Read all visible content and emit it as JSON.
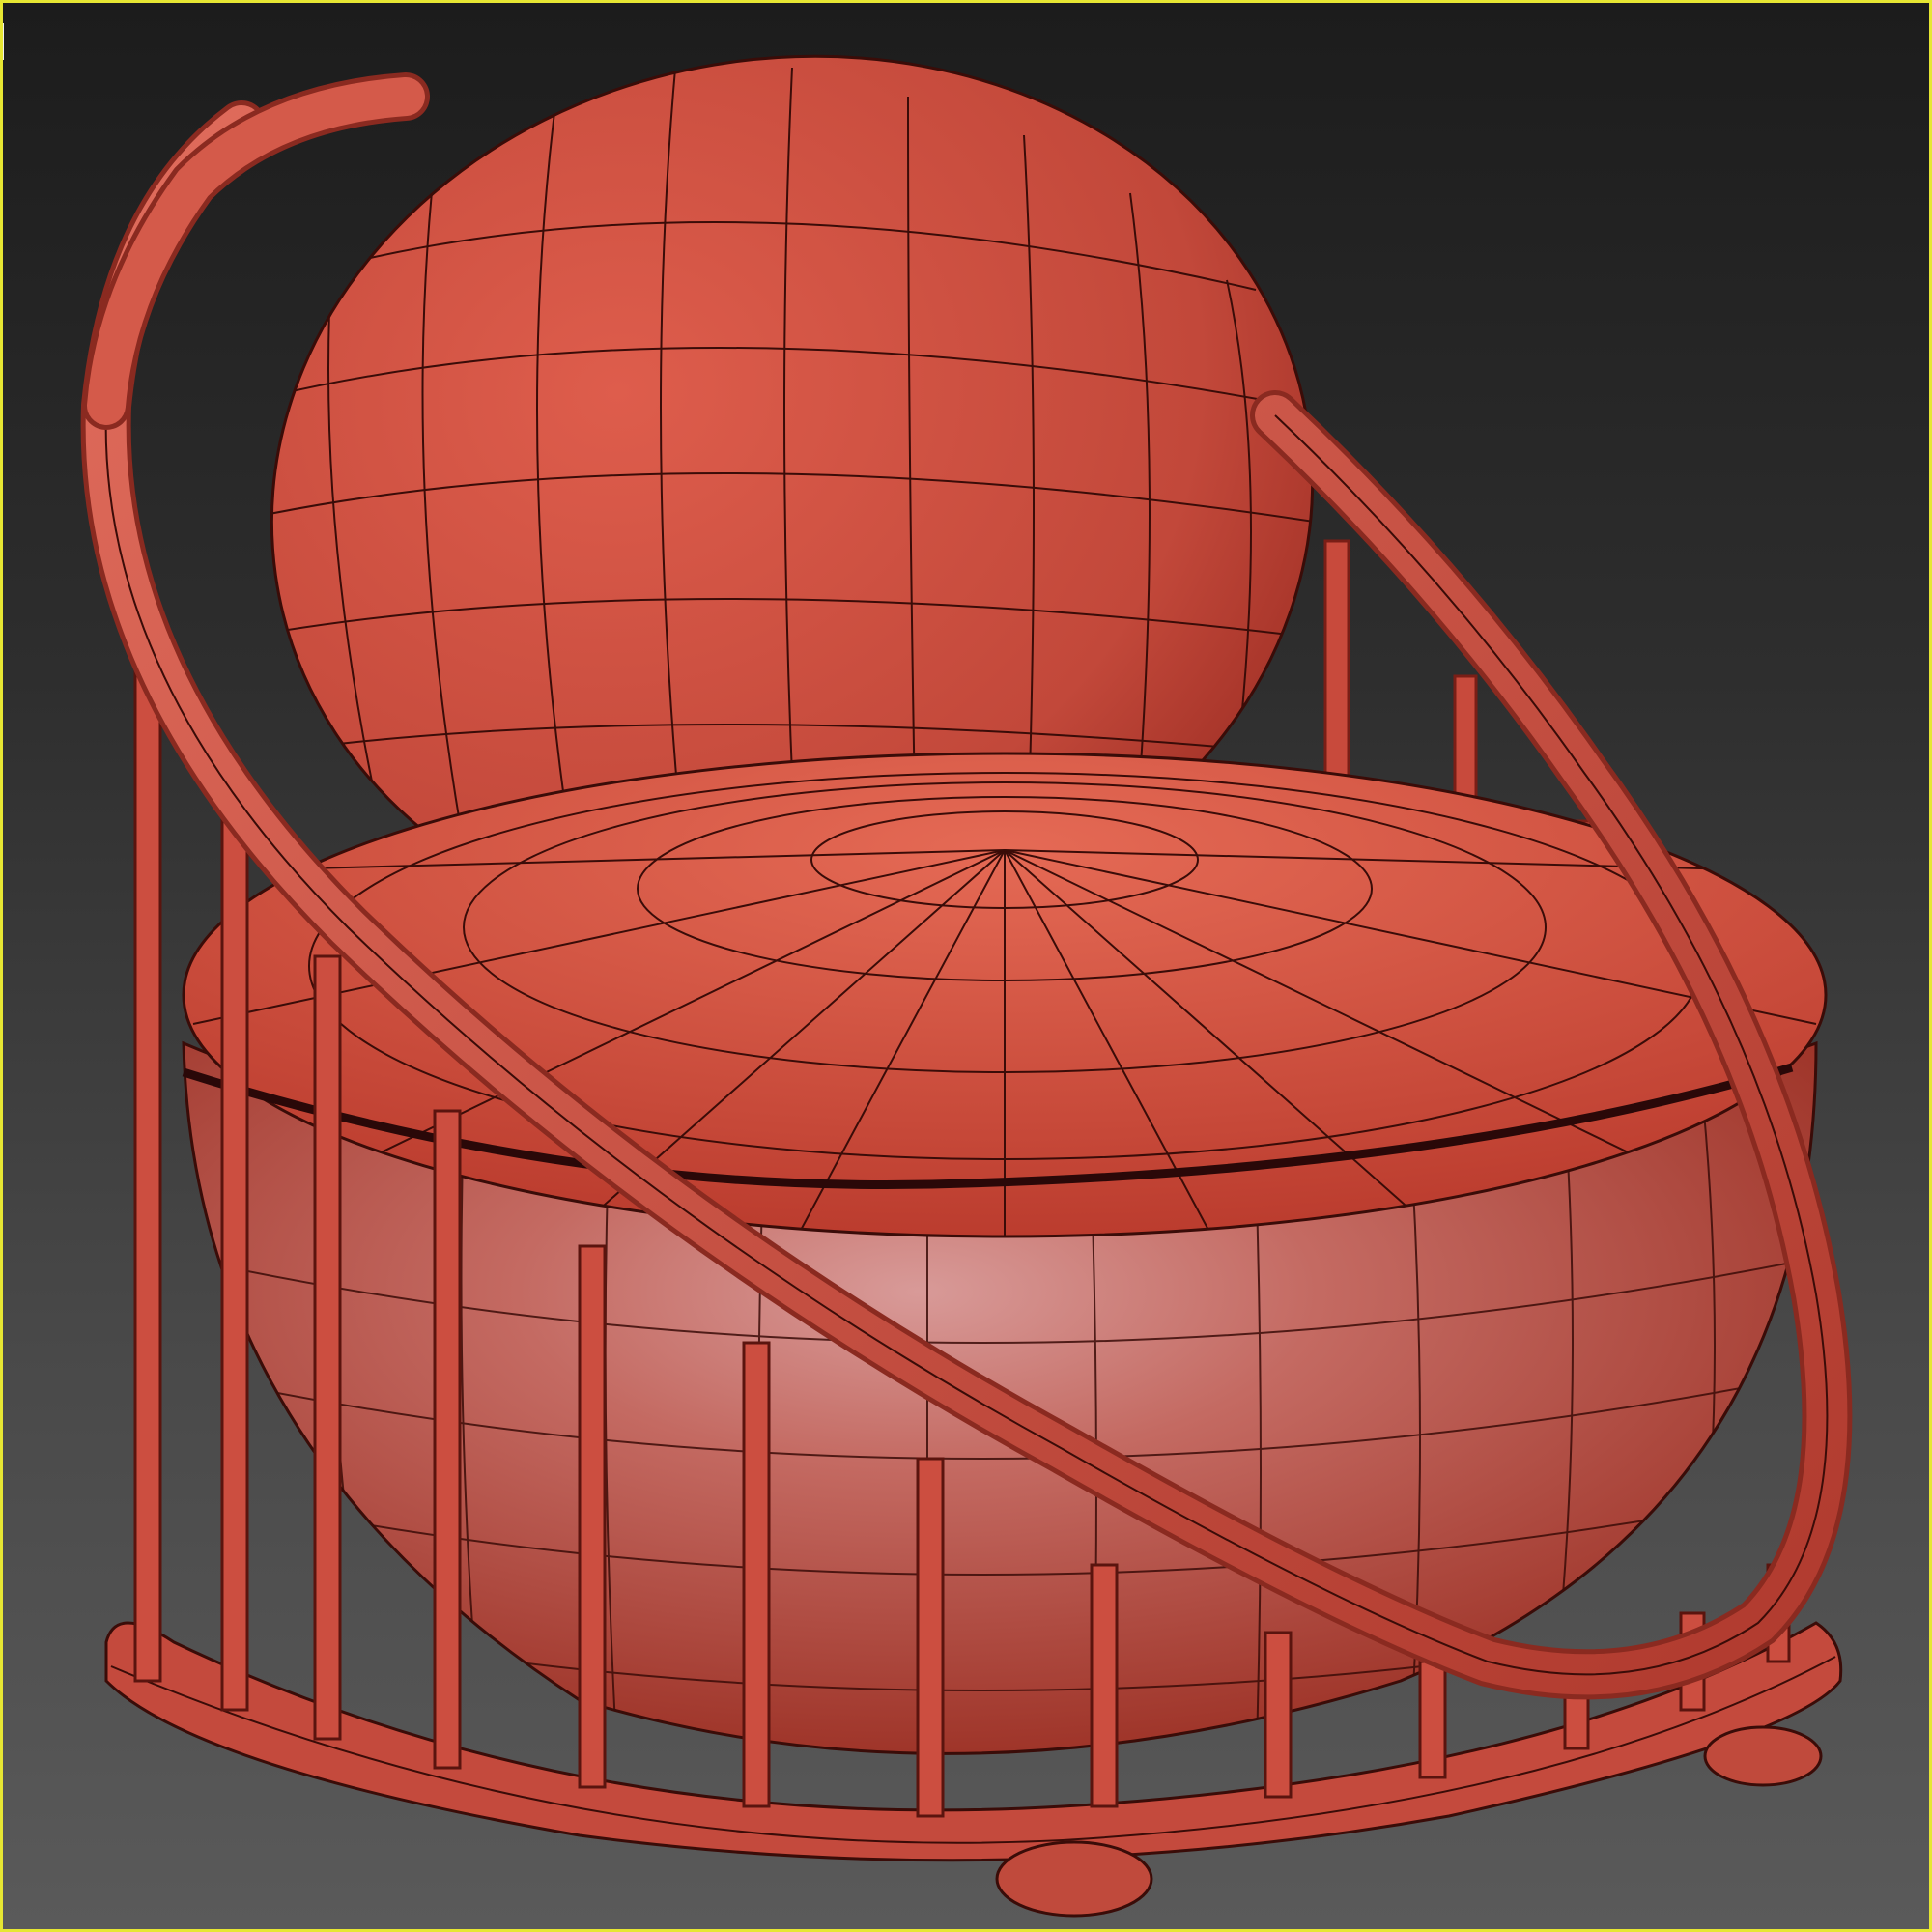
{
  "viewport": {
    "active_border_color": "#e6e633",
    "background_top": "#1c1c1c",
    "background_bottom": "#5a5a5a"
  },
  "model": {
    "object": "round-armchair",
    "display_mode": "smooth-shaded-with-edged-faces",
    "material_color": "#d65848",
    "wire_color": "#2a0808"
  }
}
